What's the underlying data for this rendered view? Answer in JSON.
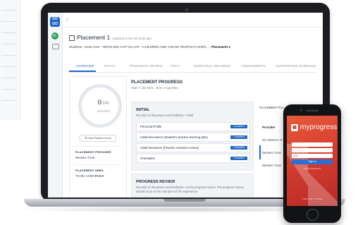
{
  "app": {
    "logo_text": "GO GO",
    "avatar_initials": "KL",
    "page_title": "Placement 1",
    "updated": "Updated a few seconds ago",
    "breadcrumbs": {
      "students": "Students",
      "student": "Kevin Kerr",
      "course": "NIPAD BSc CYP OU UAT",
      "module": "CHILDREN AND YOUNG PEOPLE'S NURS...",
      "current": "Placement 1"
    },
    "tabs": [
      "OVERVIEW",
      "INITIAL",
      "PROGRESS REVIEW",
      "FINAL",
      "ADDITIONAL RECORDS",
      "ASSESSMENTS",
      "SUPPORTING EVIDENCE"
    ],
    "hours": {
      "value": "0",
      "total": "/240",
      "label": "HOURS",
      "button": "View Practice hours"
    },
    "placement_provider": {
      "label": "PLACEMENT PROVIDER",
      "value": "Western Trust"
    },
    "placement_area": {
      "label": "PLACEMENT AREA",
      "value": "TO BE CONFIRMED"
    },
    "placement_progress": {
      "title": "PLACEMENT PROGRESS",
      "dates": "Start: 7 Jun 2021 - End: 1 Aug 2021"
    },
    "initial": {
      "title": "INITIAL",
      "subtitle": "Records of discussion and feedback—initial",
      "rows": [
        {
          "label": "Personal Profile",
          "status": "Completed"
        },
        {
          "label": "Initial Discussion (Student's practice learning plan)",
          "status": "Completed"
        },
        {
          "label": "Initial discussion (Practice Assessor review)",
          "status": "Completed"
        },
        {
          "label": "Orientation",
          "status": "Completed"
        }
      ]
    },
    "progress_review": {
      "title": "PROGRESS REVIEW",
      "subtitle": "Records of discussion and feedback—at the progress review. The progress review should occur at the mid-point of the experience."
    },
    "right_panel": {
      "header": "PLACEMENT PLA...",
      "column": "Provider",
      "rows": [
        "OU Western Tr...",
        "Western Trust",
        "Western Trust"
      ]
    }
  },
  "phone": {
    "logo_text": "myprogress",
    "fields": [
      "",
      "",
      "ATN"
    ],
    "signin": "Sign in",
    "forgot": "Forgot Password?",
    "footer": "FIND OUT MORE"
  }
}
